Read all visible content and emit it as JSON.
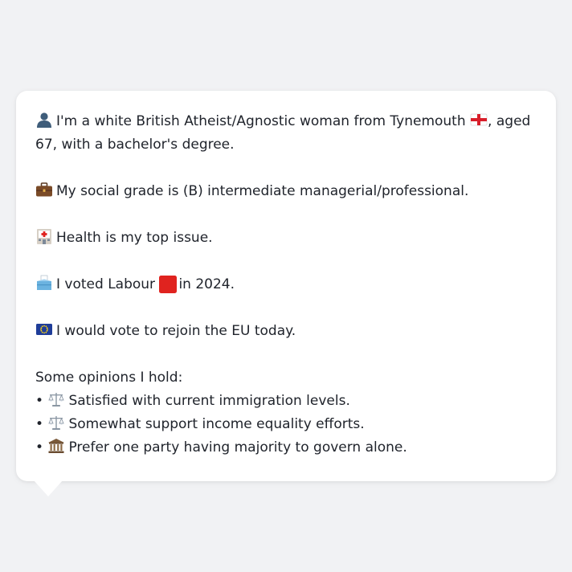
{
  "profile": {
    "intro_icon": "person-silhouette-icon",
    "intro_a": "I'm a white British Atheist/Agnostic woman from Tynemouth",
    "intro_flag": "england-flag-icon",
    "intro_b": ", aged 67, with a bachelor's degree.",
    "grade_icon": "briefcase-icon",
    "grade_text": "My social grade is (B) intermediate managerial/professional.",
    "issue_icon": "hospital-icon",
    "issue_text": "Health is my top issue.",
    "vote_icon": "ballot-box-icon",
    "vote_text_a": "I voted Labour",
    "vote_party_icon": "red-square-icon",
    "vote_text_b": "in 2024.",
    "eu_icon": "eu-flag-icon",
    "eu_text": "I would vote to rejoin the EU today."
  },
  "opinions": {
    "heading": "Some opinions I hold:",
    "bullet": "•",
    "items": [
      {
        "icon": "balance-scale-icon",
        "text": "Satisfied with current immigration levels."
      },
      {
        "icon": "balance-scale-icon",
        "text": "Somewhat support income equality efforts."
      },
      {
        "icon": "classical-building-icon",
        "text": "Prefer one party having majority to govern alone."
      }
    ]
  },
  "colors": {
    "background": "#f1f2f4",
    "bubble": "#ffffff",
    "text": "#20242c",
    "labour_red": "#e0231f",
    "eu_blue": "#1f3d99"
  }
}
